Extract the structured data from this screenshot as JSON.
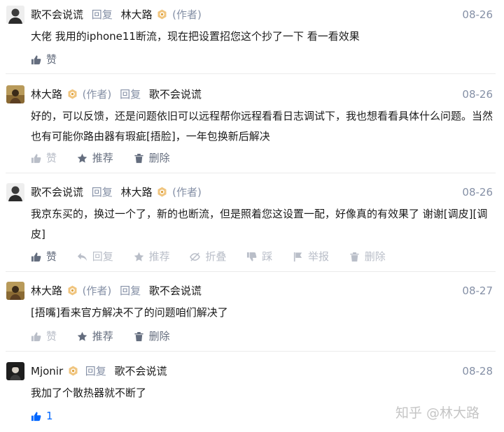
{
  "comments": [
    {
      "author": "歌不会说谎",
      "reply_label": "回复",
      "reply_to": "林大路",
      "reply_to_tag": "(作者)",
      "date": "08-26",
      "text": "大佬 我用的iphone11断流，现在把设置招您这个抄了一下 看一看效果",
      "actions": {
        "like": "赞"
      }
    },
    {
      "author": "林大路",
      "author_tag": "(作者)",
      "reply_label": "回复",
      "reply_to": "歌不会说谎",
      "date": "08-26",
      "text": "好的，可以反馈，还是问题依旧可以远程帮你远程看看日志调试下，我也想看看具体什么问题。当然也有可能你路由器有瑕疵[捂脸]，一年包换新后解决",
      "actions": {
        "like": "赞",
        "recommend": "推荐",
        "delete": "删除"
      }
    },
    {
      "author": "歌不会说谎",
      "reply_label": "回复",
      "reply_to": "林大路",
      "reply_to_tag": "(作者)",
      "date": "08-26",
      "text": "我京东买的，换过一个了，新的也断流，但是照着您这设置一配，好像真的有效果了 谢谢[调皮][调皮]",
      "actions": {
        "like": "赞",
        "reply": "回复",
        "recommend": "推荐",
        "fold": "折叠",
        "dislike": "踩",
        "report": "举报",
        "delete": "删除"
      }
    },
    {
      "author": "林大路",
      "author_tag": "(作者)",
      "reply_label": "回复",
      "reply_to": "歌不会说谎",
      "date": "08-27",
      "text": "[捂嘴]看来官方解决不了的问题咱们解决了",
      "actions": {
        "like": "赞",
        "recommend": "推荐",
        "delete": "删除"
      }
    },
    {
      "author": "Mjonir",
      "reply_label": "回复",
      "reply_to": "歌不会说谎",
      "date": "08-28",
      "text": "我加了个散热器就不断了",
      "actions": {
        "like_count": "1"
      }
    }
  ],
  "watermark": "知乎 @林大路",
  "colors": {
    "meta": "#8590a6",
    "action": "#646d7e",
    "action_muted": "#b9bec8",
    "like_active": "#0066ff",
    "divider": "#ebebeb"
  },
  "icons": [
    "thumb-up-icon",
    "reply-arrow-icon",
    "star-icon",
    "fold-icon",
    "thumb-down-icon",
    "flag-icon",
    "trash-icon",
    "author-badge-icon"
  ]
}
